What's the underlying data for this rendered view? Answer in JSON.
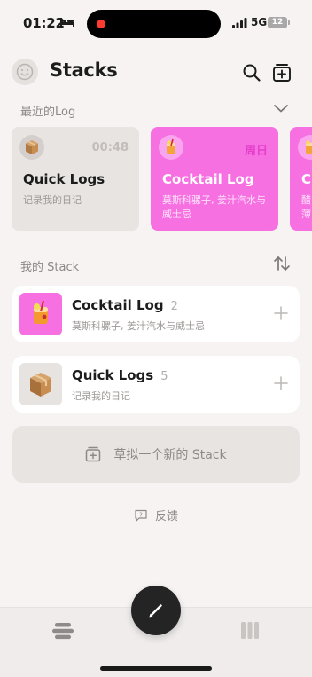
{
  "status_bar": {
    "time": "01:22",
    "network": "5G",
    "battery": "12"
  },
  "header": {
    "title": "Stacks"
  },
  "recent": {
    "label": "最近的Log",
    "cards": [
      {
        "title": "Quick Logs",
        "subtitle": "记录我的日记",
        "time": "00:48",
        "icon": "package-emoji",
        "bg": "#e8e4e2"
      },
      {
        "title": "Cocktail Log",
        "subtitle": "莫斯科骡子, 姜汁汽水与威士忌",
        "time": "周日",
        "icon": "cocktail-emoji",
        "bg": "#f770e2"
      },
      {
        "title": "C",
        "subtitle": "醋\n薄",
        "icon": "cocktail-emoji",
        "bg": "#f770e2"
      }
    ]
  },
  "stacks": {
    "label": "我的 Stack",
    "items": [
      {
        "title": "Cocktail Log",
        "count": "2",
        "subtitle": "莫斯科骡子, 姜汁汽水与威士忌",
        "icon": "cocktail-emoji"
      },
      {
        "title": "Quick Logs",
        "count": "5",
        "subtitle": "记录我的日记",
        "icon": "package-emoji"
      }
    ]
  },
  "new_stack_label": "草拟一个新的 Stack",
  "feedback_label": "反馈",
  "colors": {
    "accent_pink": "#f770e2",
    "fab": "#242424",
    "background": "#f6f3f2"
  }
}
